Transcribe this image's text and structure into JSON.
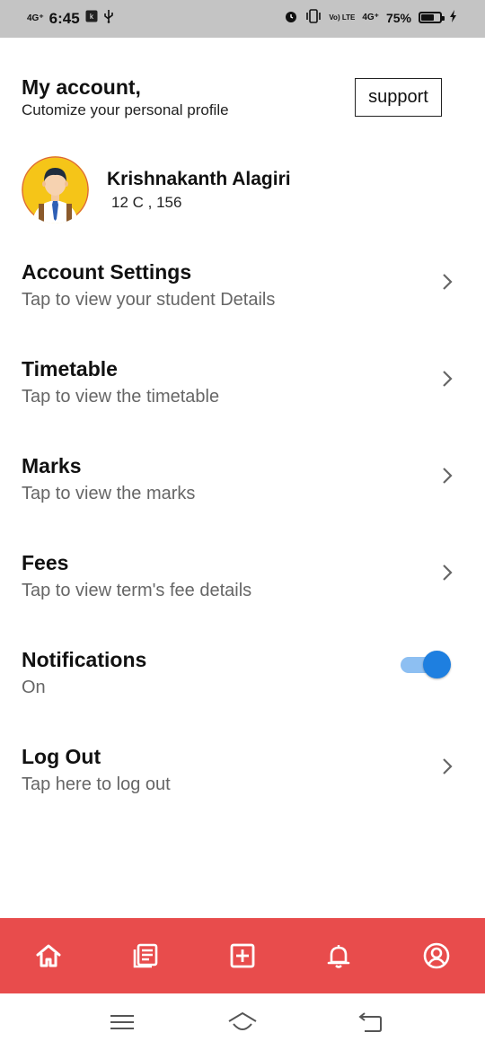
{
  "status_bar": {
    "network_left": "4G⁺",
    "time": "6:45",
    "volte": "Vo) LTE",
    "network_right": "4G⁺",
    "battery_percent": "75%",
    "battery_level": 0.75,
    "icons": [
      "signal-icon",
      "ksp-badge-icon",
      "usb-icon",
      "alarm-icon",
      "vibrate-icon",
      "charging-icon"
    ]
  },
  "header": {
    "title": "My account,",
    "subtitle": "Cutomize your personal profile",
    "support_label": "support"
  },
  "profile": {
    "name": "Krishnakanth Alagiri",
    "class_info": "12 C , 156",
    "colors": {
      "avatar_bg": "#f5c518"
    }
  },
  "menu": {
    "account": {
      "title": "Account Settings",
      "subtitle": "Tap to view your student Details"
    },
    "timetable": {
      "title": "Timetable",
      "subtitle": "Tap to view the timetable"
    },
    "marks": {
      "title": "Marks",
      "subtitle": "Tap to view the marks"
    },
    "fees": {
      "title": "Fees",
      "subtitle": "Tap to view term's fee details"
    },
    "notifications": {
      "title": "Notifications",
      "subtitle": "On",
      "enabled": true
    },
    "logout": {
      "title": "Log Out",
      "subtitle": "Tap here to log out"
    }
  },
  "bottom_nav": {
    "items": [
      "home-icon",
      "news-icon",
      "add-icon",
      "bell-icon",
      "account-icon"
    ],
    "colors": {
      "background": "#e84c4c",
      "icon": "#ffffff"
    }
  },
  "system_nav": {
    "items": [
      "menu-lines-icon",
      "home-outline-icon",
      "back-icon"
    ]
  },
  "colors": {
    "accent": "#1e7fe0",
    "text_primary": "#111111",
    "text_secondary": "#666666",
    "status_bar_bg": "#c4c4c4"
  }
}
